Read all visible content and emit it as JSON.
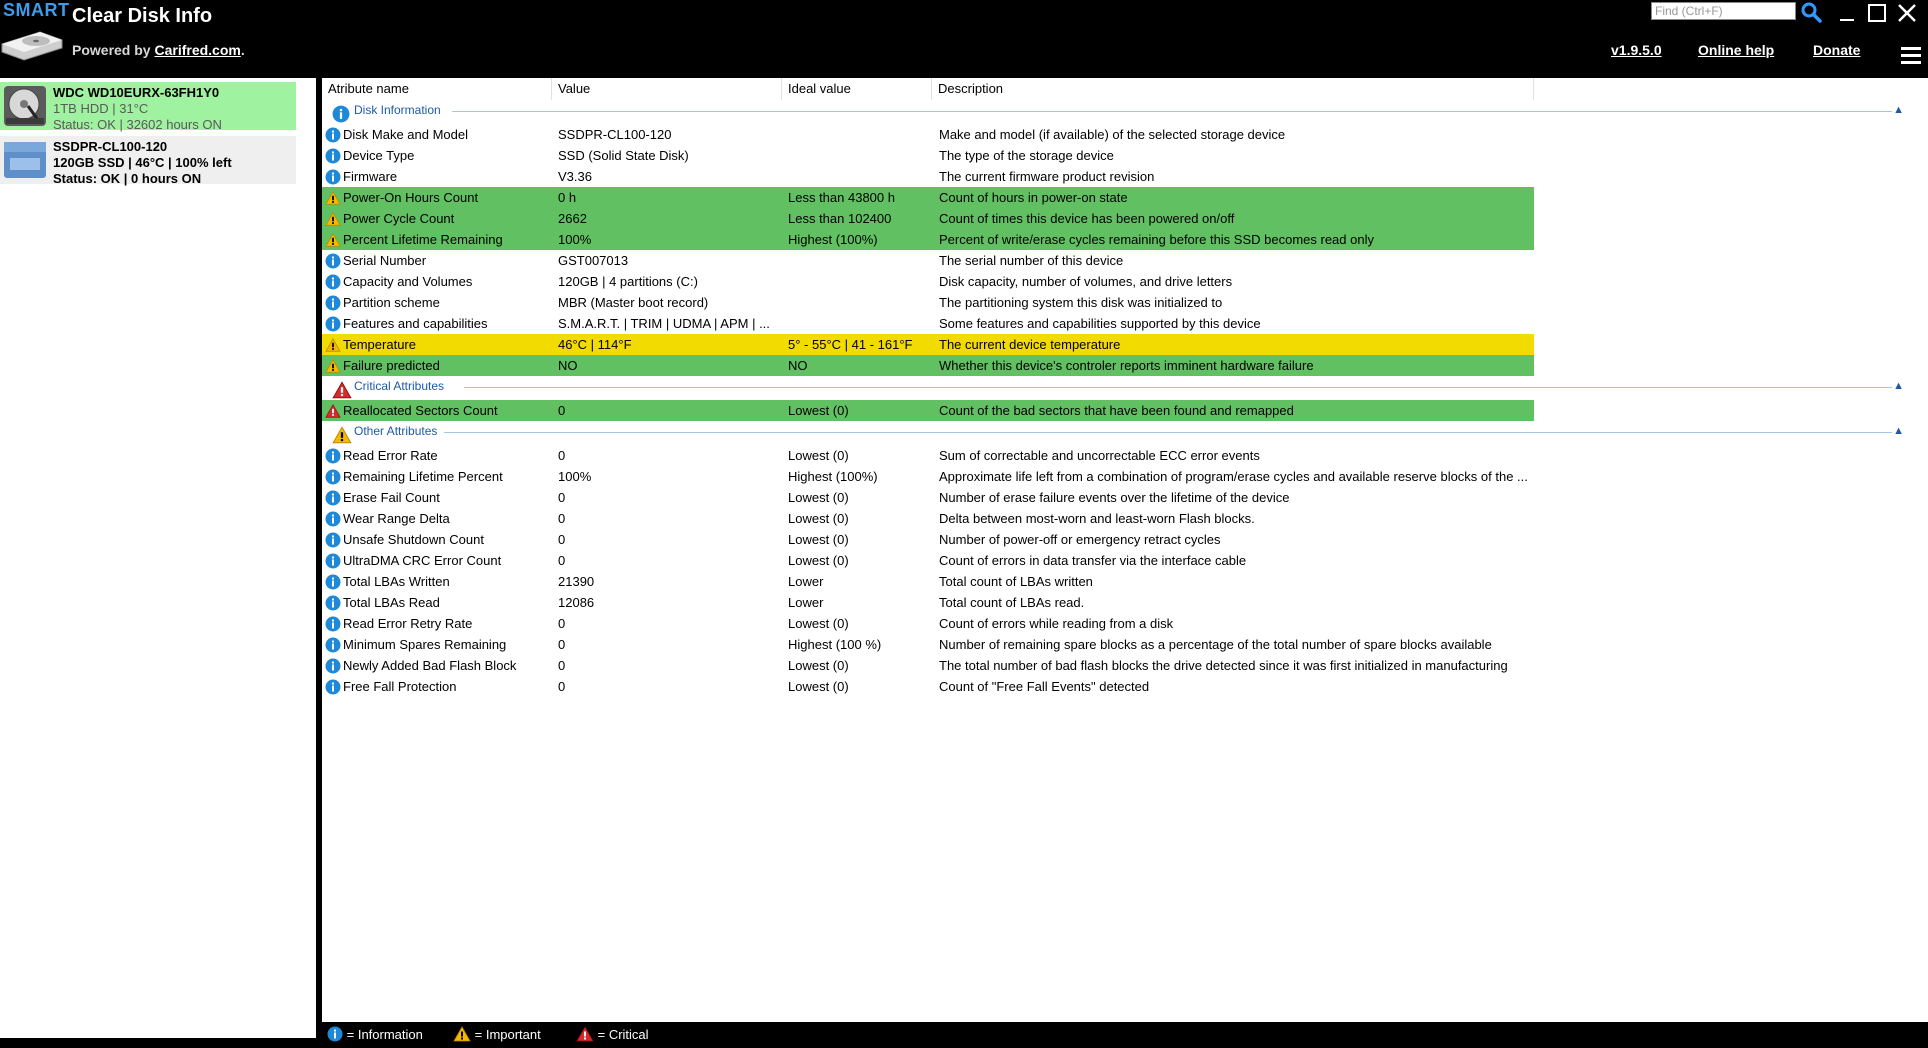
{
  "header": {
    "smart_badge": "SMART",
    "title": "Clear Disk Info",
    "powered_prefix": "Powered by ",
    "powered_link": "Carifred.com",
    "powered_suffix": ".",
    "find_placeholder": "Find (Ctrl+F)",
    "version": "v1.9.5.0",
    "online_help": "Online help",
    "donate": "Donate"
  },
  "sidebar": {
    "drives": [
      {
        "name": "WDC WD10EURX-63FH1Y0",
        "line2": "1TB HDD | 31°C",
        "line3": "Status: OK | 32602 hours ON",
        "icon": "hdd-icon",
        "selected": true
      },
      {
        "name": "SSDPR-CL100-120",
        "line2": "120GB  SSD | 46°C | 100% left",
        "line3": "Status: OK | 0 hours ON",
        "icon": "ssd-icon",
        "selected": false
      }
    ]
  },
  "table": {
    "columns": [
      "Atribute name",
      "Value",
      "Ideal value",
      "Description"
    ],
    "groups": [
      {
        "label": "Disk Information",
        "icon": "info-icon",
        "rows": [
          {
            "icon": "info-icon",
            "name": "Disk Make and Model",
            "value": "SSDPR-CL100-120",
            "ideal": "",
            "desc": "Make and model (if available) of the selected storage device",
            "status": "none"
          },
          {
            "icon": "info-icon",
            "name": "Device Type",
            "value": "SSD (Solid State Disk)",
            "ideal": "",
            "desc": "The type of the storage device",
            "status": "none"
          },
          {
            "icon": "info-icon",
            "name": "Firmware",
            "value": "V3.36",
            "ideal": "",
            "desc": "The current firmware product revision",
            "status": "none"
          },
          {
            "icon": "warning-icon",
            "name": "Power-On Hours Count",
            "value": "0 h",
            "ideal": "Less than 43800 h",
            "desc": "Count of hours in power-on state",
            "status": "green"
          },
          {
            "icon": "warning-icon",
            "name": "Power Cycle Count",
            "value": "2662",
            "ideal": "Less than 102400",
            "desc": "Count of times this device has been powered on/off",
            "status": "green"
          },
          {
            "icon": "warning-icon",
            "name": "Percent Lifetime Remaining",
            "value": "100%",
            "ideal": "Highest (100%)",
            "desc": "Percent of write/erase cycles remaining before this SSD becomes read only",
            "status": "green"
          },
          {
            "icon": "info-icon",
            "name": "Serial Number",
            "value": "GST007013",
            "ideal": "",
            "desc": "The serial number of this device",
            "status": "none"
          },
          {
            "icon": "info-icon",
            "name": "Capacity and Volumes",
            "value": "120GB | 4 partitions (C:)",
            "ideal": "",
            "desc": "Disk capacity, number of volumes, and drive letters",
            "status": "none"
          },
          {
            "icon": "info-icon",
            "name": "Partition scheme",
            "value": "MBR (Master boot record)",
            "ideal": "",
            "desc": "The partitioning system this disk was initialized to",
            "status": "none"
          },
          {
            "icon": "info-icon",
            "name": "Features and capabilities",
            "value": "S.M.A.R.T. | TRIM | UDMA | APM | ...",
            "ideal": "",
            "desc": "Some features and capabilities supported by this device",
            "status": "none"
          },
          {
            "icon": "warning-icon",
            "name": "Temperature",
            "value": "46°C | 114°F",
            "ideal": "5° - 55°C | 41 - 161°F",
            "desc": "The current device temperature",
            "status": "yellow"
          },
          {
            "icon": "warning-icon",
            "name": "Failure predicted",
            "value": "NO",
            "ideal": "NO",
            "desc": "Whether this device's controler reports imminent hardware failure",
            "status": "green"
          }
        ]
      },
      {
        "label": "Critical Attributes",
        "icon": "critical-icon",
        "rows": [
          {
            "icon": "critical-icon",
            "name": "Reallocated Sectors Count",
            "value": "0",
            "ideal": "Lowest (0)",
            "desc": "Count of the bad sectors that have been found and remapped",
            "status": "green"
          }
        ]
      },
      {
        "label": "Other Attributes",
        "icon": "warning-icon",
        "rows": [
          {
            "icon": "info-icon",
            "name": "Read Error Rate",
            "value": "0",
            "ideal": "Lowest (0)",
            "desc": "Sum of correctable and uncorrectable ECC error events",
            "status": "none"
          },
          {
            "icon": "info-icon",
            "name": "Remaining Lifetime Percent",
            "value": "100%",
            "ideal": "Highest (100%)",
            "desc": "Approximate life left from a combination of program/erase cycles and available reserve blocks of the ...",
            "status": "none"
          },
          {
            "icon": "info-icon",
            "name": "Erase Fail Count",
            "value": "0",
            "ideal": "Lowest (0)",
            "desc": "Number of erase failure events over the lifetime of the device",
            "status": "none"
          },
          {
            "icon": "info-icon",
            "name": "Wear Range Delta",
            "value": "0",
            "ideal": "Lowest (0)",
            "desc": "Delta between most-worn and least-worn Flash blocks.",
            "status": "none"
          },
          {
            "icon": "info-icon",
            "name": "Unsafe Shutdown Count",
            "value": "0",
            "ideal": "Lowest (0)",
            "desc": "Number of power-off or emergency retract cycles",
            "status": "none"
          },
          {
            "icon": "info-icon",
            "name": "UltraDMA CRC Error Count",
            "value": "0",
            "ideal": "Lowest (0)",
            "desc": "Count of errors in data transfer via the interface cable",
            "status": "none"
          },
          {
            "icon": "info-icon",
            "name": "Total LBAs Written",
            "value": "21390",
            "ideal": "Lower",
            "desc": "Total count of LBAs written",
            "status": "none"
          },
          {
            "icon": "info-icon",
            "name": "Total LBAs Read",
            "value": "12086",
            "ideal": "Lower",
            "desc": "Total count of LBAs read.",
            "status": "none"
          },
          {
            "icon": "info-icon",
            "name": "Read Error Retry Rate",
            "value": "0",
            "ideal": "Lowest (0)",
            "desc": "Count of errors while reading from a disk",
            "status": "none"
          },
          {
            "icon": "info-icon",
            "name": "Minimum Spares Remaining",
            "value": "0",
            "ideal": "Highest (100 %)",
            "desc": "Number of remaining spare blocks as a percentage of the total number of spare blocks available",
            "status": "none"
          },
          {
            "icon": "info-icon",
            "name": "Newly Added Bad Flash Block",
            "value": "0",
            "ideal": "Lowest (0)",
            "desc": "The total number of bad flash blocks the drive detected since it was first initialized in manufacturing",
            "status": "none"
          },
          {
            "icon": "info-icon",
            "name": "Free Fall Protection",
            "value": "0",
            "ideal": "Lowest (0)",
            "desc": "Count of \"Free Fall Events\" detected",
            "status": "none"
          }
        ]
      }
    ]
  },
  "legend": {
    "info": "= Information",
    "important": "= Important",
    "critical": "= Critical"
  },
  "colors": {
    "ok_green": "#61c061",
    "warn_yellow": "#f2db00",
    "selected_drive": "#9ff29f",
    "info_blue": "#1e88d9",
    "group_blue": "#1d5aa8"
  }
}
